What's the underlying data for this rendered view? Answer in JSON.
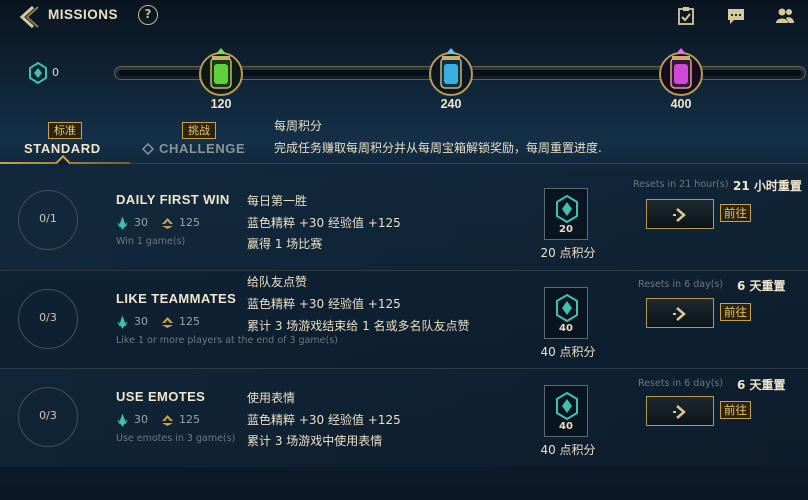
{
  "header": {
    "title": "MISSIONS",
    "help_symbol": "?"
  },
  "currency": {
    "value": "0",
    "icon": "hextech-token-icon"
  },
  "track": {
    "chests": [
      {
        "label": "120",
        "color": "#5fcf3a"
      },
      {
        "label": "240",
        "color": "#3ab0e0"
      },
      {
        "label": "400",
        "color": "#d04ad8"
      }
    ]
  },
  "tabs": {
    "standard": {
      "badge": "标准",
      "label": "STANDARD"
    },
    "challenge": {
      "badge": "挑战",
      "label": "CHALLENGE"
    }
  },
  "weekly": {
    "title": "每周积分",
    "description": "完成任务赚取每周积分并从每周宝箱解锁奖励，每周重置进度."
  },
  "missions": [
    {
      "progress": "0/1",
      "name": "DAILY FIRST WIN",
      "essence": "30",
      "xp": "125",
      "desc_en": "Win 1 game(s)",
      "cn_title": "每日第一胜",
      "cn_rewards": "蓝色精粹 +30  经验值 +125",
      "cn_desc": "赢得 1 场比赛",
      "points": "20",
      "points_label": "20 点积分",
      "reset_en": "Resets in 21 hour(s)",
      "reset_cn": "21 小时重置",
      "go_label": "前往"
    },
    {
      "progress": "0/3",
      "name": "LIKE TEAMMATES",
      "essence": "30",
      "xp": "125",
      "desc_en": "Like 1 or more players at the end of 3 game(s)",
      "cn_title": "给队友点赞",
      "cn_rewards": "蓝色精粹 +30  经验值 +125",
      "cn_desc": "累计 3 场游戏结束给 1 名或多名队友点赞",
      "points": "40",
      "points_label": "40 点积分",
      "reset_en": "Resets in 6 day(s)",
      "reset_cn": "6 天重置",
      "go_label": "前往"
    },
    {
      "progress": "0/3",
      "name": "USE EMOTES",
      "essence": "30",
      "xp": "125",
      "desc_en": "Use emotes in 3 game(s)",
      "cn_title": "使用表情",
      "cn_rewards": "蓝色精粹 +30  经验值 +125",
      "cn_desc": "累计 3 场游戏中使用表情",
      "points": "40",
      "points_label": "40 点积分",
      "reset_en": "Resets in 6 day(s)",
      "reset_cn": "6 天重置",
      "go_label": "前往"
    }
  ],
  "colors": {
    "gold": "#c8a24a",
    "teal": "#3fc0b0",
    "text": "#e8dcc0"
  }
}
